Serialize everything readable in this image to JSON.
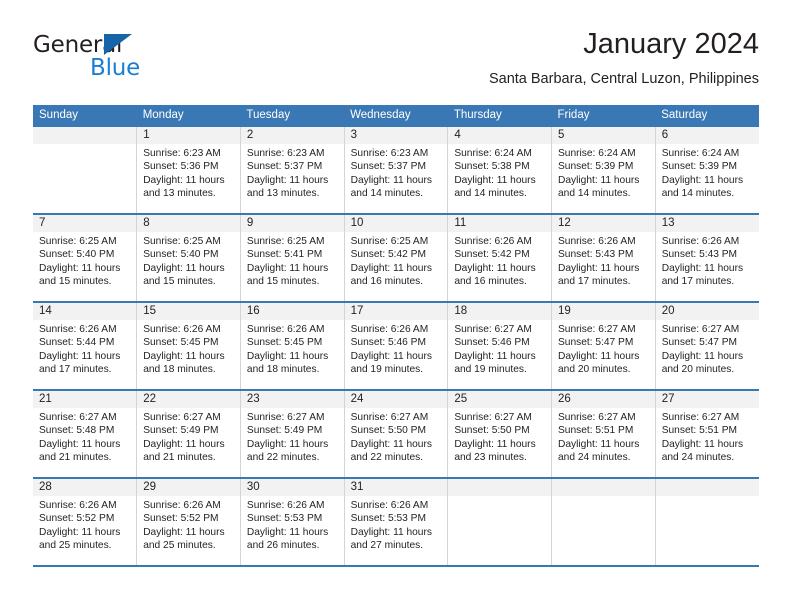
{
  "logo": {
    "text_top": "General",
    "text_bottom": "Blue",
    "triangle_color": "#1565A8",
    "blue_color": "#1A7FD4"
  },
  "header": {
    "title": "January 2024",
    "subtitle": "Santa Barbara, Central Luzon, Philippines"
  },
  "theme": {
    "header_blue": "#3A78B5",
    "band_gray": "#F2F2F2",
    "grid_gray": "#D4D4D4",
    "text": "#231F20"
  },
  "calendar": {
    "day_headers": [
      "Sunday",
      "Monday",
      "Tuesday",
      "Wednesday",
      "Thursday",
      "Friday",
      "Saturday"
    ],
    "weeks": [
      [
        {
          "day": "",
          "sunrise": "",
          "sunset": "",
          "daylight_line1": "",
          "daylight_line2": ""
        },
        {
          "day": "1",
          "sunrise": "Sunrise: 6:23 AM",
          "sunset": "Sunset: 5:36 PM",
          "daylight_line1": "Daylight: 11 hours",
          "daylight_line2": "and 13 minutes."
        },
        {
          "day": "2",
          "sunrise": "Sunrise: 6:23 AM",
          "sunset": "Sunset: 5:37 PM",
          "daylight_line1": "Daylight: 11 hours",
          "daylight_line2": "and 13 minutes."
        },
        {
          "day": "3",
          "sunrise": "Sunrise: 6:23 AM",
          "sunset": "Sunset: 5:37 PM",
          "daylight_line1": "Daylight: 11 hours",
          "daylight_line2": "and 14 minutes."
        },
        {
          "day": "4",
          "sunrise": "Sunrise: 6:24 AM",
          "sunset": "Sunset: 5:38 PM",
          "daylight_line1": "Daylight: 11 hours",
          "daylight_line2": "and 14 minutes."
        },
        {
          "day": "5",
          "sunrise": "Sunrise: 6:24 AM",
          "sunset": "Sunset: 5:39 PM",
          "daylight_line1": "Daylight: 11 hours",
          "daylight_line2": "and 14 minutes."
        },
        {
          "day": "6",
          "sunrise": "Sunrise: 6:24 AM",
          "sunset": "Sunset: 5:39 PM",
          "daylight_line1": "Daylight: 11 hours",
          "daylight_line2": "and 14 minutes."
        }
      ],
      [
        {
          "day": "7",
          "sunrise": "Sunrise: 6:25 AM",
          "sunset": "Sunset: 5:40 PM",
          "daylight_line1": "Daylight: 11 hours",
          "daylight_line2": "and 15 minutes."
        },
        {
          "day": "8",
          "sunrise": "Sunrise: 6:25 AM",
          "sunset": "Sunset: 5:40 PM",
          "daylight_line1": "Daylight: 11 hours",
          "daylight_line2": "and 15 minutes."
        },
        {
          "day": "9",
          "sunrise": "Sunrise: 6:25 AM",
          "sunset": "Sunset: 5:41 PM",
          "daylight_line1": "Daylight: 11 hours",
          "daylight_line2": "and 15 minutes."
        },
        {
          "day": "10",
          "sunrise": "Sunrise: 6:25 AM",
          "sunset": "Sunset: 5:42 PM",
          "daylight_line1": "Daylight: 11 hours",
          "daylight_line2": "and 16 minutes."
        },
        {
          "day": "11",
          "sunrise": "Sunrise: 6:26 AM",
          "sunset": "Sunset: 5:42 PM",
          "daylight_line1": "Daylight: 11 hours",
          "daylight_line2": "and 16 minutes."
        },
        {
          "day": "12",
          "sunrise": "Sunrise: 6:26 AM",
          "sunset": "Sunset: 5:43 PM",
          "daylight_line1": "Daylight: 11 hours",
          "daylight_line2": "and 17 minutes."
        },
        {
          "day": "13",
          "sunrise": "Sunrise: 6:26 AM",
          "sunset": "Sunset: 5:43 PM",
          "daylight_line1": "Daylight: 11 hours",
          "daylight_line2": "and 17 minutes."
        }
      ],
      [
        {
          "day": "14",
          "sunrise": "Sunrise: 6:26 AM",
          "sunset": "Sunset: 5:44 PM",
          "daylight_line1": "Daylight: 11 hours",
          "daylight_line2": "and 17 minutes."
        },
        {
          "day": "15",
          "sunrise": "Sunrise: 6:26 AM",
          "sunset": "Sunset: 5:45 PM",
          "daylight_line1": "Daylight: 11 hours",
          "daylight_line2": "and 18 minutes."
        },
        {
          "day": "16",
          "sunrise": "Sunrise: 6:26 AM",
          "sunset": "Sunset: 5:45 PM",
          "daylight_line1": "Daylight: 11 hours",
          "daylight_line2": "and 18 minutes."
        },
        {
          "day": "17",
          "sunrise": "Sunrise: 6:26 AM",
          "sunset": "Sunset: 5:46 PM",
          "daylight_line1": "Daylight: 11 hours",
          "daylight_line2": "and 19 minutes."
        },
        {
          "day": "18",
          "sunrise": "Sunrise: 6:27 AM",
          "sunset": "Sunset: 5:46 PM",
          "daylight_line1": "Daylight: 11 hours",
          "daylight_line2": "and 19 minutes."
        },
        {
          "day": "19",
          "sunrise": "Sunrise: 6:27 AM",
          "sunset": "Sunset: 5:47 PM",
          "daylight_line1": "Daylight: 11 hours",
          "daylight_line2": "and 20 minutes."
        },
        {
          "day": "20",
          "sunrise": "Sunrise: 6:27 AM",
          "sunset": "Sunset: 5:47 PM",
          "daylight_line1": "Daylight: 11 hours",
          "daylight_line2": "and 20 minutes."
        }
      ],
      [
        {
          "day": "21",
          "sunrise": "Sunrise: 6:27 AM",
          "sunset": "Sunset: 5:48 PM",
          "daylight_line1": "Daylight: 11 hours",
          "daylight_line2": "and 21 minutes."
        },
        {
          "day": "22",
          "sunrise": "Sunrise: 6:27 AM",
          "sunset": "Sunset: 5:49 PM",
          "daylight_line1": "Daylight: 11 hours",
          "daylight_line2": "and 21 minutes."
        },
        {
          "day": "23",
          "sunrise": "Sunrise: 6:27 AM",
          "sunset": "Sunset: 5:49 PM",
          "daylight_line1": "Daylight: 11 hours",
          "daylight_line2": "and 22 minutes."
        },
        {
          "day": "24",
          "sunrise": "Sunrise: 6:27 AM",
          "sunset": "Sunset: 5:50 PM",
          "daylight_line1": "Daylight: 11 hours",
          "daylight_line2": "and 22 minutes."
        },
        {
          "day": "25",
          "sunrise": "Sunrise: 6:27 AM",
          "sunset": "Sunset: 5:50 PM",
          "daylight_line1": "Daylight: 11 hours",
          "daylight_line2": "and 23 minutes."
        },
        {
          "day": "26",
          "sunrise": "Sunrise: 6:27 AM",
          "sunset": "Sunset: 5:51 PM",
          "daylight_line1": "Daylight: 11 hours",
          "daylight_line2": "and 24 minutes."
        },
        {
          "day": "27",
          "sunrise": "Sunrise: 6:27 AM",
          "sunset": "Sunset: 5:51 PM",
          "daylight_line1": "Daylight: 11 hours",
          "daylight_line2": "and 24 minutes."
        }
      ],
      [
        {
          "day": "28",
          "sunrise": "Sunrise: 6:26 AM",
          "sunset": "Sunset: 5:52 PM",
          "daylight_line1": "Daylight: 11 hours",
          "daylight_line2": "and 25 minutes."
        },
        {
          "day": "29",
          "sunrise": "Sunrise: 6:26 AM",
          "sunset": "Sunset: 5:52 PM",
          "daylight_line1": "Daylight: 11 hours",
          "daylight_line2": "and 25 minutes."
        },
        {
          "day": "30",
          "sunrise": "Sunrise: 6:26 AM",
          "sunset": "Sunset: 5:53 PM",
          "daylight_line1": "Daylight: 11 hours",
          "daylight_line2": "and 26 minutes."
        },
        {
          "day": "31",
          "sunrise": "Sunrise: 6:26 AM",
          "sunset": "Sunset: 5:53 PM",
          "daylight_line1": "Daylight: 11 hours",
          "daylight_line2": "and 27 minutes."
        },
        {
          "day": "",
          "sunrise": "",
          "sunset": "",
          "daylight_line1": "",
          "daylight_line2": ""
        },
        {
          "day": "",
          "sunrise": "",
          "sunset": "",
          "daylight_line1": "",
          "daylight_line2": ""
        },
        {
          "day": "",
          "sunrise": "",
          "sunset": "",
          "daylight_line1": "",
          "daylight_line2": ""
        }
      ]
    ]
  }
}
